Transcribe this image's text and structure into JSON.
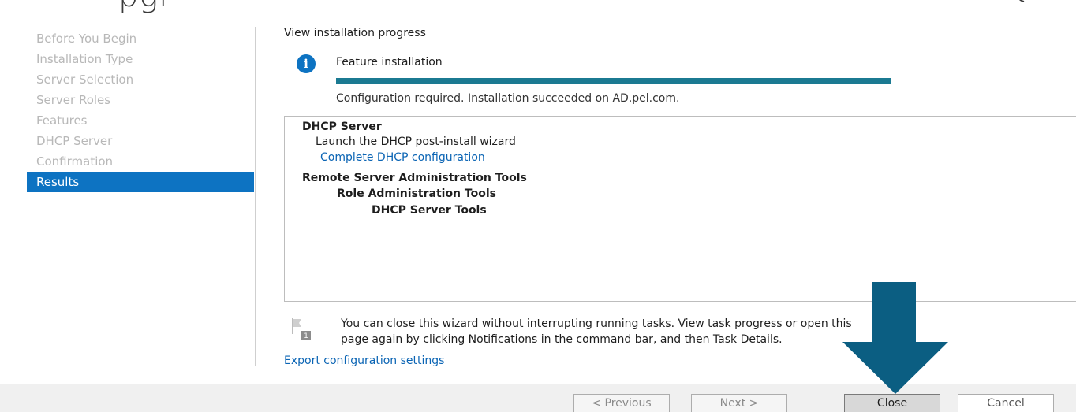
{
  "header": {
    "title_fragment": "pgi"
  },
  "sidebar": {
    "items": [
      {
        "label": "Before You Begin"
      },
      {
        "label": "Installation Type"
      },
      {
        "label": "Server Selection"
      },
      {
        "label": "Server Roles"
      },
      {
        "label": "Features"
      },
      {
        "label": "DHCP Server"
      },
      {
        "label": "Confirmation"
      },
      {
        "label": "Results",
        "active": true
      }
    ]
  },
  "main": {
    "heading": "View installation progress",
    "feature": {
      "title": "Feature installation",
      "progress": 1.0,
      "status": "Configuration required. Installation succeeded on AD.pel.com."
    },
    "results": {
      "dhcp_server": "DHCP Server",
      "launch_wizard": "Launch the DHCP post-install wizard",
      "complete_link": "Complete DHCP configuration",
      "rsat": "Remote Server Administration Tools",
      "role_admin_tools": "Role Administration Tools",
      "dhcp_server_tools": "DHCP Server Tools"
    },
    "note": {
      "line1": "You can close this wizard without interrupting running tasks. View task progress or open this",
      "line2": "page again by clicking Notifications in the command bar, and then Task Details.",
      "badge": "1"
    },
    "export_link": "Export configuration settings"
  },
  "footer": {
    "previous_label": "< Previous",
    "next_label": "Next >",
    "close_label": "Close",
    "cancel_label": "Cancel"
  },
  "colors": {
    "accent": "#0d73c2",
    "progress": "#1b7a92",
    "link": "#0a64b4",
    "arrow": "#0b5e82"
  }
}
